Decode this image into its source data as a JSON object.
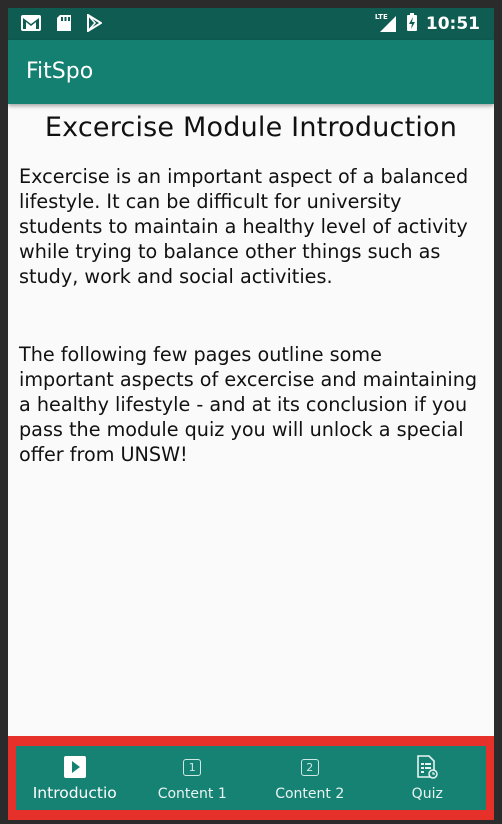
{
  "status_bar": {
    "left_icons": [
      "gmail-icon",
      "sd-card-icon",
      "play-store-icon"
    ],
    "network_label": "LTE",
    "time": "10:51"
  },
  "app_bar": {
    "title": "FitSpo"
  },
  "main": {
    "heading": "Excercise Module Introduction",
    "paragraphs": [
      "Excercise is an important aspect of a balanced lifestyle. It can be difficult for university students to maintain a healthy level of activity while trying to balance other things such as study, work and social activities.",
      "The following few pages outline some important aspects of excercise and maintaining a healthy lifestyle - and at its conclusion if you pass the module quiz you will unlock a special offer from UNSW!"
    ]
  },
  "bottom_nav": {
    "items": [
      {
        "label": "Introductio",
        "icon": "play-icon",
        "active": true
      },
      {
        "label": "Content 1",
        "icon": "number-1-icon",
        "badge": "1",
        "active": false
      },
      {
        "label": "Content 2",
        "icon": "number-2-icon",
        "badge": "2",
        "active": false
      },
      {
        "label": "Quiz",
        "icon": "quiz-document-icon",
        "active": false
      }
    ]
  },
  "colors": {
    "status_bar": "#0e5c52",
    "app_bar": "#138072",
    "bottom_nav": "#168273",
    "highlight_border": "#e53129",
    "background": "#fafafa"
  }
}
